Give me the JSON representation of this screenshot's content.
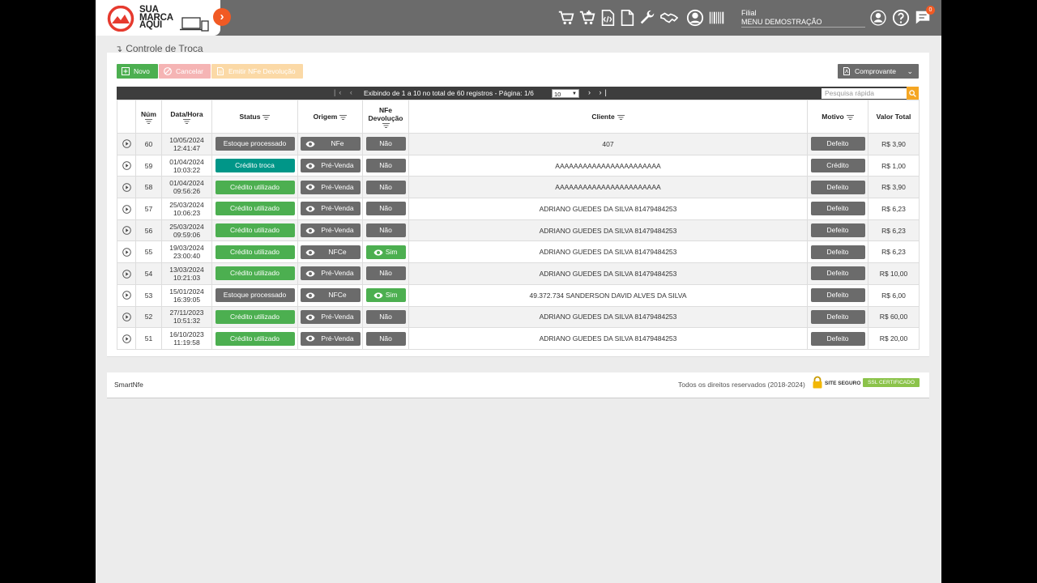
{
  "brand": {
    "line1": "SUA",
    "line2": "MARCA",
    "line3": "AQUI"
  },
  "topbar": {
    "icons": [
      "cart-icon",
      "cart-plus-icon",
      "xml-file-icon",
      "document-icon",
      "wrench-icon",
      "handshake-icon",
      "user-circle-icon",
      "barcode-icon",
      "account-icon",
      "help-icon",
      "chat-icon"
    ],
    "filial_label": "Filial",
    "filial_value": "MENU DEMOSTRAÇÃO",
    "notifications": "0"
  },
  "breadcrumb": {
    "title": "Controle de Troca"
  },
  "toolbar": {
    "novo": "Novo",
    "cancelar": "Cancelar",
    "emitir": "Emitir NFe Devolução",
    "comprovante": "Comprovante"
  },
  "pager": {
    "info": "Exibindo de 1 a 10 no total de 60 registros - Página: 1/6",
    "page_size": "10",
    "search_placeholder": "Pesquisa rápida"
  },
  "table": {
    "headers": {
      "num": "Núm",
      "datahora": "Data/Hora",
      "status": "Status",
      "origem": "Origem",
      "nfe1": "NFe",
      "nfe2": "Devolução",
      "cliente": "Cliente",
      "motivo": "Motivo",
      "valor": "Valor Total"
    },
    "rows": [
      {
        "num": "60",
        "date": "10/05/2024",
        "time": "12:41:47",
        "status": "Estoque processado",
        "status_type": "gray",
        "origem": "NFe",
        "nfe": "Não",
        "cliente": "407",
        "motivo": "Defeito",
        "valor": "R$ 3,90"
      },
      {
        "num": "59",
        "date": "01/04/2024",
        "time": "10:03:22",
        "status": "Crédito troca",
        "status_type": "teal",
        "origem": "Pré-Venda",
        "nfe": "Não",
        "cliente": "AAAAAAAAAAAAAAAAAAAAAAA",
        "motivo": "Crédito",
        "valor": "R$ 1,00"
      },
      {
        "num": "58",
        "date": "01/04/2024",
        "time": "09:56:26",
        "status": "Crédito utilizado",
        "status_type": "green",
        "origem": "Pré-Venda",
        "nfe": "Não",
        "cliente": "AAAAAAAAAAAAAAAAAAAAAAA",
        "motivo": "Defeito",
        "valor": "R$ 3,90"
      },
      {
        "num": "57",
        "date": "25/03/2024",
        "time": "10:06:23",
        "status": "Crédito utilizado",
        "status_type": "green",
        "origem": "Pré-Venda",
        "nfe": "Não",
        "cliente": "ADRIANO GUEDES DA SILVA 81479484253",
        "motivo": "Defeito",
        "valor": "R$ 6,23"
      },
      {
        "num": "56",
        "date": "25/03/2024",
        "time": "09:59:06",
        "status": "Crédito utilizado",
        "status_type": "green",
        "origem": "Pré-Venda",
        "nfe": "Não",
        "cliente": "ADRIANO GUEDES DA SILVA 81479484253",
        "motivo": "Defeito",
        "valor": "R$ 6,23"
      },
      {
        "num": "55",
        "date": "19/03/2024",
        "time": "23:00:40",
        "status": "Crédito utilizado",
        "status_type": "green",
        "origem": "NFCe",
        "nfe": "Sim",
        "cliente": "ADRIANO GUEDES DA SILVA 81479484253",
        "motivo": "Defeito",
        "valor": "R$ 6,23"
      },
      {
        "num": "54",
        "date": "13/03/2024",
        "time": "10:21:03",
        "status": "Crédito utilizado",
        "status_type": "green",
        "origem": "Pré-Venda",
        "nfe": "Não",
        "cliente": "ADRIANO GUEDES DA SILVA 81479484253",
        "motivo": "Defeito",
        "valor": "R$ 10,00"
      },
      {
        "num": "53",
        "date": "15/01/2024",
        "time": "16:39:05",
        "status": "Estoque processado",
        "status_type": "gray",
        "origem": "NFCe",
        "nfe": "Sim",
        "cliente": "49.372.734 SANDERSON DAVID ALVES DA SILVA",
        "motivo": "Defeito",
        "valor": "R$ 6,00"
      },
      {
        "num": "52",
        "date": "27/11/2023",
        "time": "10:51:32",
        "status": "Crédito utilizado",
        "status_type": "green",
        "origem": "Pré-Venda",
        "nfe": "Não",
        "cliente": "ADRIANO GUEDES DA SILVA 81479484253",
        "motivo": "Defeito",
        "valor": "R$ 60,00"
      },
      {
        "num": "51",
        "date": "16/10/2023",
        "time": "11:19:58",
        "status": "Crédito utilizado",
        "status_type": "green",
        "origem": "Pré-Venda",
        "nfe": "Não",
        "cliente": "ADRIANO GUEDES DA SILVA 81479484253",
        "motivo": "Defeito",
        "valor": "R$ 20,00"
      }
    ]
  },
  "footer": {
    "app": "SmartNfe",
    "rights": "Todos os direitos reservados (2018-2024)",
    "ssl_site": "SITE SEGURO",
    "ssl_cert": "SSL CERTIFICADO"
  },
  "colors": {
    "topbar": "#6b6b6b",
    "accent": "#f15a24",
    "green": "#4caf50",
    "teal": "#009688",
    "gray_pill": "#6b6b6b"
  }
}
